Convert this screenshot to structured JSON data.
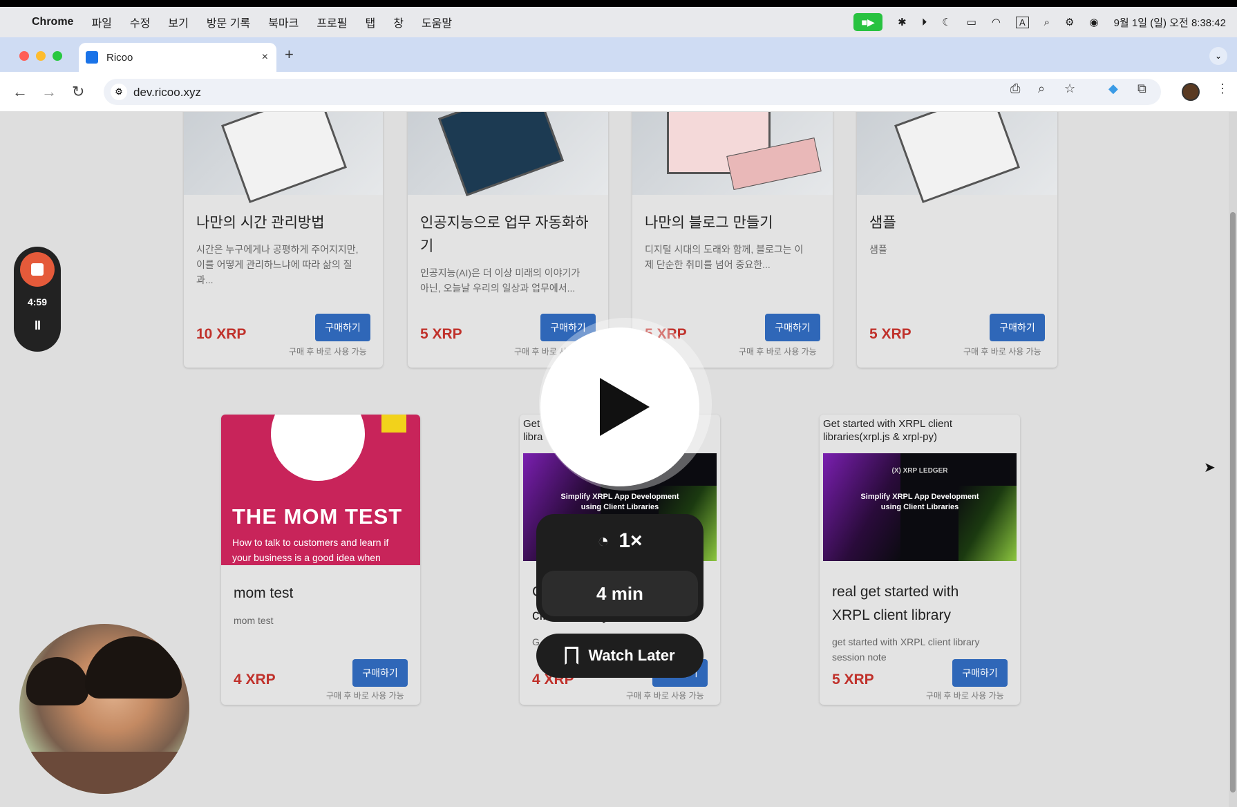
{
  "menubar": {
    "app": "Chrome",
    "items": [
      "파일",
      "수정",
      "보기",
      "방문 기록",
      "북마크",
      "프로필",
      "탭",
      "창",
      "도움말"
    ],
    "clock": "9월 1일 (일) 오전 8:38:42",
    "input_indicator": "A"
  },
  "tab": {
    "title": "Ricoo",
    "close": "×",
    "new_tab": "+"
  },
  "toolbar": {
    "url": "dev.ricoo.xyz"
  },
  "recorder": {
    "time": "4:59",
    "pause": "II"
  },
  "products_row1": [
    {
      "title_lines": [
        "나만의 시간 관리방법"
      ],
      "desc_lines": [
        "시간은 누구에게나 공평하게 주어지지만,",
        "이를 어떻게 관리하느냐에 따라 삶의 질",
        "과..."
      ],
      "price": "10 XRP",
      "buy": "구매하기",
      "note": "구매 후 바로 사용 가능"
    },
    {
      "title_lines": [
        "인공지능으로 업무 자동화하",
        "기"
      ],
      "desc_lines": [
        "인공지능(AI)은 더 이상 미래의 이야기가",
        "아닌, 오늘날 우리의 일상과 업무에서..."
      ],
      "price": "5 XRP",
      "buy": "구매하기",
      "note": "구매 후 바로 사용 가능"
    },
    {
      "title_lines": [
        "나만의 블로그 만들기"
      ],
      "desc_lines": [
        "디지털 시대의 도래와 함께, 블로그는 이",
        "제 단순한 취미를 넘어 중요한..."
      ],
      "price": "5 XRP",
      "buy": "구매하기",
      "note": "구매 후 바로 사용 가능"
    },
    {
      "title_lines": [
        "샘플"
      ],
      "desc_lines": [
        "샘플"
      ],
      "price": "5 XRP",
      "buy": "구매하기",
      "note": "구매 후 바로 사용 가능"
    }
  ],
  "products_row2": [
    {
      "cover_title": "THE MOM TEST",
      "cover_sub_lines": [
        "How to talk to customers and learn if",
        "your business is a good idea when"
      ],
      "title_lines": [
        "mom test"
      ],
      "desc_lines": [
        "mom test"
      ],
      "price": "4 XRP",
      "buy": "구매하기",
      "note": "구매 후 바로 사용 가능"
    },
    {
      "header_lines": [
        "Get",
        "libra"
      ],
      "thumb_lines": [
        "Simplify XRPL App Development",
        "using Client Libraries"
      ],
      "title_lines": [
        "C",
        "client library"
      ],
      "desc_lines": [
        "G"
      ],
      "price": "4 XRP",
      "buy": "구매하기",
      "note": "구매 후 바로 사용 가능"
    },
    {
      "header_lines": [
        "Get started with XRPL client",
        "libraries(xrpl.js & xrpl-py)"
      ],
      "thumb_lines": [
        "Simplify XRPL App Development",
        "using Client Libraries"
      ],
      "thumb_top": "(X) XRP LEDGER",
      "title_lines": [
        "real get started with",
        "XRPL client library"
      ],
      "desc_lines": [
        "get started with XRPL client library",
        "session note"
      ],
      "price": "5 XRP",
      "buy": "구매하기",
      "note": "구매 후 바로 사용 가능"
    }
  ],
  "overlay": {
    "speed": "1×",
    "duration": "4 min",
    "watch_later": "Watch Later"
  },
  "colors": {
    "price": "#c0312b",
    "buy_button": "#2f67b8",
    "mom_test_cover": "#c8245a",
    "recorder_stop": "#e55a3a",
    "facetime": "#28c240"
  }
}
